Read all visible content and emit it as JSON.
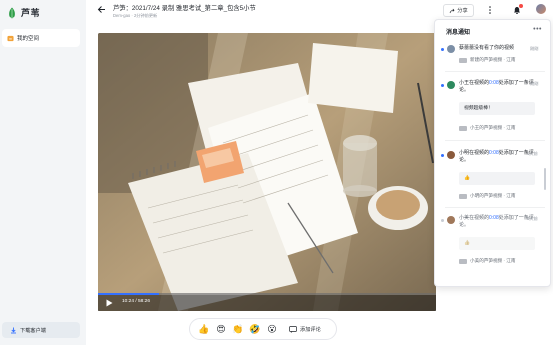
{
  "app": {
    "name": "芦苇"
  },
  "sidebar": {
    "items": [
      {
        "label": "我的空间",
        "icon": "home-icon"
      }
    ],
    "download_label": "下载客户端"
  },
  "header": {
    "title": "芦笋：2021/7/24 录制 雅思考试_第二章_包含5小节",
    "subtitle": "Dem-gao · 2分钟前更新",
    "share_label": "分享"
  },
  "player": {
    "time": "10:24 / 58:26",
    "progress": 0.18
  },
  "reactions": {
    "emojis": [
      "👍",
      "😍",
      "👏",
      "🤣",
      "😮"
    ],
    "comment_label": "添加评论"
  },
  "notifications": {
    "title": "消息通知",
    "items": [
      {
        "text_a": "蔡蕾蕾没有看了你的视频",
        "time": "刚刚",
        "video": "新建的芦笋视频 · 江南",
        "avatar_color": "#7c8fa6"
      },
      {
        "text_a": "小王在视频的",
        "hl": "0:08",
        "text_b": "处添加了一条评论。",
        "time": "刚刚",
        "quote": "视频超级棒！",
        "video": "小王的芦笋视频 · 江南",
        "avatar_color": "#2d8a5f"
      },
      {
        "text_a": "小明在视频的",
        "hl": "0:08",
        "text_b": "处添加了一条评论。",
        "time": "1天前",
        "quote": "👍",
        "video": "小明的芦笋视频 · 江南",
        "avatar_color": "#8a5a3c"
      },
      {
        "text_a": "小美在视频的",
        "hl": "0:08",
        "text_b": "处添加了一条评论。",
        "time": "3天前",
        "quote": "👍",
        "video": "小美的芦笋视频 · 江南",
        "avatar_color": "#a0785a"
      }
    ]
  },
  "colors": {
    "accent": "#3370ff",
    "brand": "#2e9d48"
  }
}
